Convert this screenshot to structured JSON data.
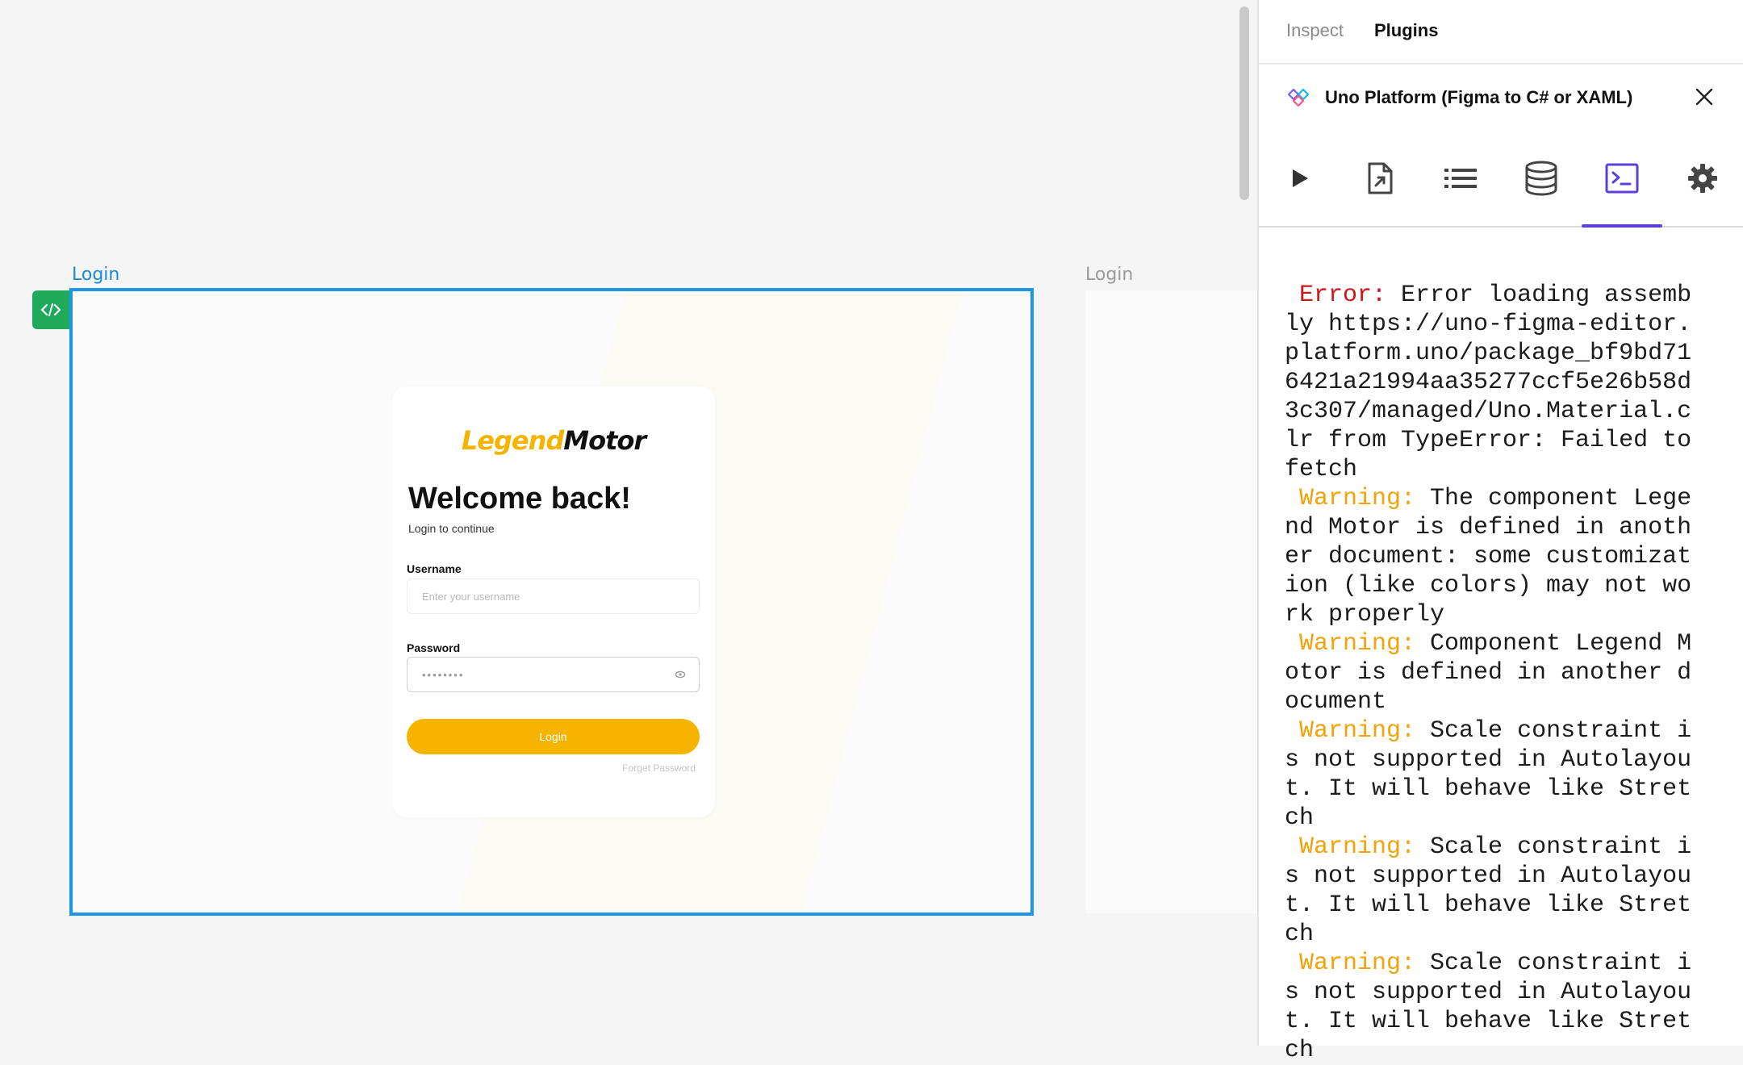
{
  "canvas": {
    "frames": [
      {
        "label": "Login",
        "selected": true
      },
      {
        "label": "Login",
        "selected": false
      }
    ],
    "code_badge_icon": "code-brackets-icon",
    "login_screen": {
      "brand_part_1": "Legend",
      "brand_part_2": "Motor",
      "title": "Welcome back!",
      "subtitle": "Login to continue",
      "username_label": "Username",
      "username_placeholder": "Enter your username",
      "password_label": "Password",
      "password_value": "••••••••",
      "login_button": "Login",
      "forget_password": "Forget Password",
      "accent_color": "#f5b400"
    }
  },
  "panel": {
    "tabs": [
      {
        "label": "Inspect",
        "active": false
      },
      {
        "label": "Plugins",
        "active": true
      }
    ],
    "plugin_title": "Uno Platform (Figma to C# or XAML)",
    "toolbar": [
      {
        "icon": "play-icon",
        "active": false
      },
      {
        "icon": "export-file-icon",
        "active": false
      },
      {
        "icon": "list-icon",
        "active": false
      },
      {
        "icon": "database-icon",
        "active": false
      },
      {
        "icon": "terminal-icon",
        "active": true
      },
      {
        "icon": "gear-icon",
        "active": false
      }
    ],
    "console_logs": [
      {
        "level": "Error:",
        "message": "Error loading assembly https://uno-figma-editor.platform.uno/package_bf9bd716421a21994aa35277ccf5e26b58d3c307/managed/Uno.Material.clr from TypeError: Failed to fetch"
      },
      {
        "level": "Warning:",
        "message": "The component Legend Motor is defined in another document: some customization (like colors) may not work properly"
      },
      {
        "level": "Warning:",
        "message": "Component Legend Motor is defined in another document"
      },
      {
        "level": "Warning:",
        "message": "Scale constraint is not supported in Autolayout. It will behave like Stretch"
      },
      {
        "level": "Warning:",
        "message": "Scale constraint is not supported in Autolayout. It will behave like Stretch"
      },
      {
        "level": "Warning:",
        "message": "Scale constraint is not supported in Autolayout. It will behave like Stretch"
      }
    ],
    "colors": {
      "error": "#d0141b",
      "warning": "#f3a20a",
      "active_tab": "#5b3fd6"
    }
  }
}
